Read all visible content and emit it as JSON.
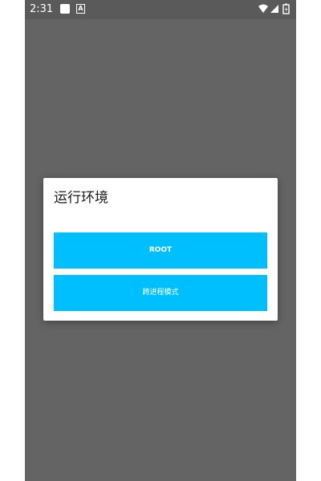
{
  "status_bar": {
    "time": "2:31",
    "notif_icon_label": "A",
    "icons": [
      "notification-square-icon",
      "notification-a-icon",
      "wifi-icon",
      "signal-icon",
      "battery-icon"
    ]
  },
  "dialog": {
    "title": "运行环境",
    "buttons": [
      {
        "label": "ROOT"
      },
      {
        "label": "跨进程模式"
      }
    ]
  },
  "colors": {
    "scrim": "#646464",
    "status_bar": "#5a5a5a",
    "dialog_bg": "#ffffff",
    "button_accent": "#00bfff",
    "button_text": "#ffffff"
  }
}
